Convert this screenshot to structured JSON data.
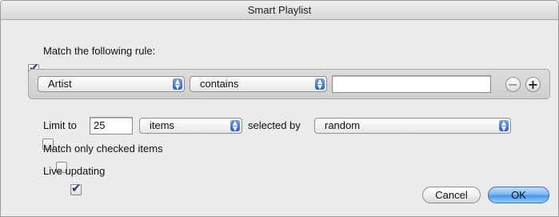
{
  "window": {
    "title": "Smart Playlist"
  },
  "match_rule": {
    "checked": true,
    "label": "Match the following rule:"
  },
  "rule": {
    "field": "Artist",
    "operator": "contains",
    "value": ""
  },
  "limit": {
    "checked": false,
    "label": "Limit to",
    "amount": "25",
    "unit": "items",
    "selected_by_label": "selected by",
    "selected_by": "random"
  },
  "match_checked": {
    "checked": false,
    "label": "Match only checked items"
  },
  "live_updating": {
    "checked": true,
    "label": "Live updating"
  },
  "buttons": {
    "remove": "⊖",
    "add": "+",
    "cancel": "Cancel",
    "ok": "OK"
  }
}
